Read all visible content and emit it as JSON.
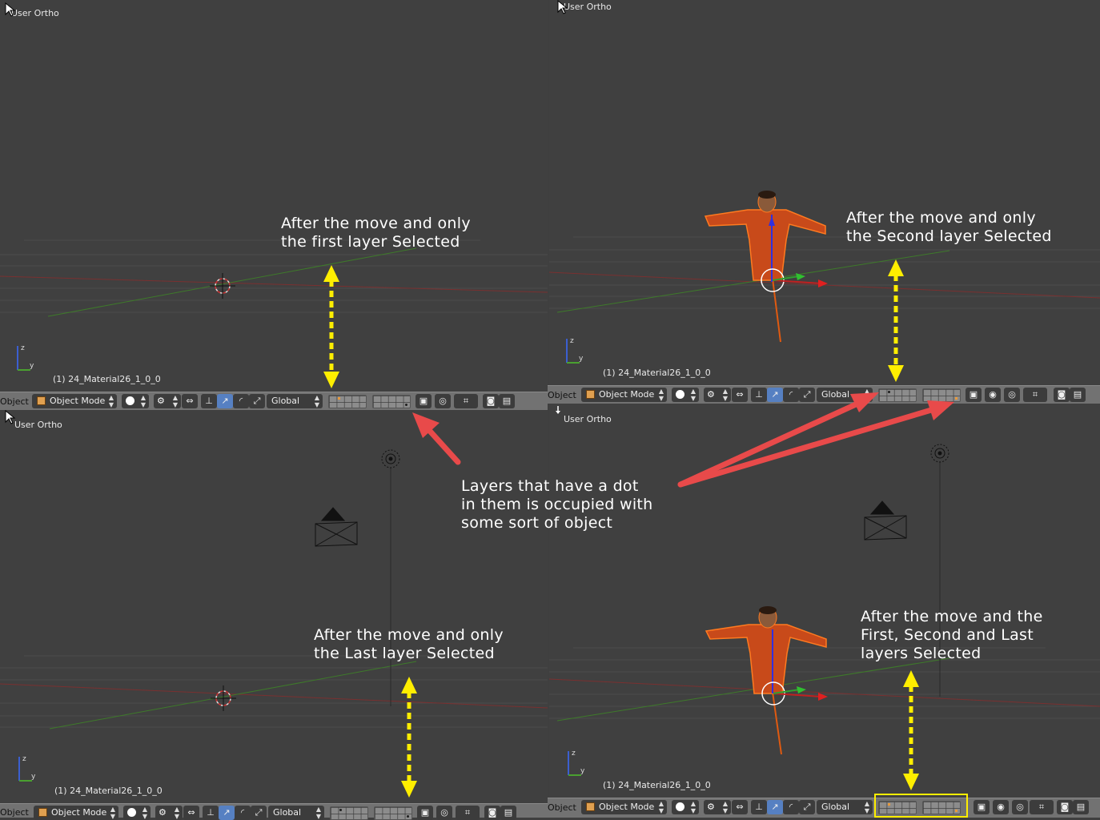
{
  "panels": [
    {
      "id": "tl",
      "title": "User Ortho",
      "object_info": "(1) 24_Material26_1_0_0",
      "mode_label": "Object",
      "mode_value": "Object Mode",
      "orientation": "Global",
      "annotation": [
        "After the move and only",
        "the first layer Selected"
      ]
    },
    {
      "id": "tr",
      "title": "User Ortho",
      "object_info": "(1) 24_Material26_1_0_0",
      "mode_label": "Object",
      "mode_value": "Object Mode",
      "orientation": "Global",
      "annotation": [
        "After the move and only",
        "the Second layer Selected"
      ]
    },
    {
      "id": "bl",
      "title": "User Ortho",
      "object_info": "(1) 24_Material26_1_0_0",
      "mode_label": "Object",
      "mode_value": "Object Mode",
      "orientation": "Global",
      "annotation": [
        "After the move and only",
        "the Last layer Selected"
      ]
    },
    {
      "id": "br",
      "title": "User Ortho",
      "object_info": "(1) 24_Material26_1_0_0",
      "mode_label": "Object",
      "mode_value": "Object Mode",
      "orientation": "Global",
      "annotation": [
        "After the move and the",
        "First, Second and Last",
        "layers Selected"
      ]
    }
  ],
  "callout": [
    "Layers that have a dot",
    "in them is occupied with",
    "some sort of object"
  ],
  "colors": {
    "annotation_arrow": "#ffee00",
    "callout_arrow": "#e84a4a",
    "highlight": "#ffee00",
    "active_layer": "#e89a3c",
    "axis_x": "#b03030",
    "axis_y": "#4a9a2a"
  },
  "icons": [
    "cube-icon",
    "sphere-shading-icon",
    "pivot-icon",
    "manipulator-icon",
    "layer-grid-icon",
    "render-icon",
    "camera-icon",
    "clapper-icon"
  ]
}
